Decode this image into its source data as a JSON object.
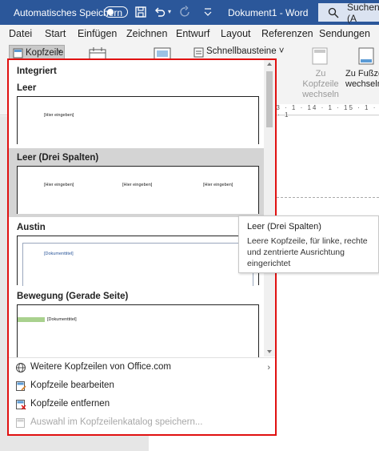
{
  "titlebar": {
    "autosave_label": "Automatisches Speichern",
    "document_title": "Dokument1  -  Word",
    "search_label": "Suchen (A"
  },
  "ribbon_tabs": [
    "Datei",
    "Start",
    "Einfügen",
    "Zeichnen",
    "Entwurf",
    "Layout",
    "Referenzen",
    "Sendungen"
  ],
  "ribbon": {
    "header_button": "Kopfzeile",
    "quick_parts": "Schnellbausteine",
    "goto_header": "Zu Kopfzeile wechseln",
    "goto_footer": "Zu Fußzeile wechseln"
  },
  "ruler_text": "· 13 · 1 · 14 · 1 · 15 · 1 · 16 · 1",
  "gallery": {
    "category": "Integriert",
    "items": [
      {
        "name": "Leer",
        "placeholders": [
          "[Hier eingeben]"
        ]
      },
      {
        "name": "Leer (Drei Spalten)",
        "placeholders": [
          "[Hier eingeben]",
          "[Hier eingeben]",
          "[Hier eingeben]"
        ]
      },
      {
        "name": "Austin",
        "placeholders": [
          "[Dokumenttitel]"
        ]
      },
      {
        "name": "Bewegung (Gerade Seite)",
        "placeholders": [
          "[Dokumenttitel]"
        ]
      }
    ],
    "menu": [
      {
        "label": "Weitere Kopfzeilen von Office.com",
        "enabled": true,
        "submenu": true
      },
      {
        "label": "Kopfzeile bearbeiten",
        "enabled": true,
        "submenu": false
      },
      {
        "label": "Kopfzeile entfernen",
        "enabled": true,
        "submenu": false
      },
      {
        "label": "Auswahl im Kopfzeilenkatalog speichern...",
        "enabled": false,
        "submenu": false
      }
    ]
  },
  "tooltip": {
    "title": "Leer (Drei Spalten)",
    "body": "Leere Kopfzeile, für linke, rechte und zentrierte Ausrichtung eingerichtet"
  },
  "colors": {
    "titlebar": "#2b579a",
    "highlight_border": "#e01010",
    "selected_item": "#d4d4d4",
    "motion_bar": "#a9d18e"
  }
}
